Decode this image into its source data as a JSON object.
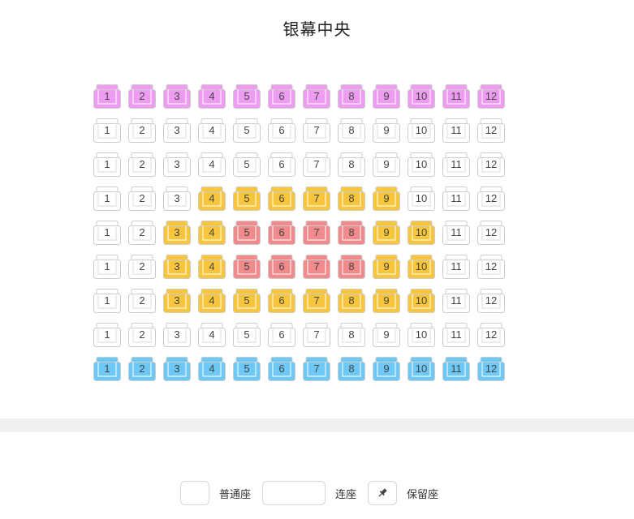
{
  "screen": {
    "title": "银幕中央"
  },
  "colors": {
    "normal": {
      "fill": "#ffffff",
      "stroke": "#cccccc"
    },
    "pink": {
      "fill": "#ee9cf2",
      "stroke": "#cccccc"
    },
    "yellow": {
      "fill": "#f8c63d",
      "stroke": "#cccccc"
    },
    "red": {
      "fill": "#f08a8c",
      "stroke": "#cccccc"
    },
    "blue": {
      "fill": "#6ec8f5",
      "stroke": "#cccccc"
    }
  },
  "seat_rows": [
    {
      "seats": [
        [
          "1",
          "pink"
        ],
        [
          "2",
          "pink"
        ],
        [
          "3",
          "pink"
        ],
        [
          "4",
          "pink"
        ],
        [
          "5",
          "pink"
        ],
        [
          "6",
          "pink"
        ],
        [
          "7",
          "pink"
        ],
        [
          "8",
          "pink"
        ],
        [
          "9",
          "pink"
        ],
        [
          "10",
          "pink"
        ],
        [
          "11",
          "pink"
        ],
        [
          "12",
          "pink"
        ]
      ]
    },
    {
      "seats": [
        [
          "1",
          "normal"
        ],
        [
          "2",
          "normal"
        ],
        [
          "3",
          "normal"
        ],
        [
          "4",
          "normal"
        ],
        [
          "5",
          "normal"
        ],
        [
          "6",
          "normal"
        ],
        [
          "7",
          "normal"
        ],
        [
          "8",
          "normal"
        ],
        [
          "9",
          "normal"
        ],
        [
          "10",
          "normal"
        ],
        [
          "11",
          "normal"
        ],
        [
          "12",
          "normal"
        ]
      ]
    },
    {
      "seats": [
        [
          "1",
          "normal"
        ],
        [
          "2",
          "normal"
        ],
        [
          "3",
          "normal"
        ],
        [
          "4",
          "normal"
        ],
        [
          "5",
          "normal"
        ],
        [
          "6",
          "normal"
        ],
        [
          "7",
          "normal"
        ],
        [
          "8",
          "normal"
        ],
        [
          "9",
          "normal"
        ],
        [
          "10",
          "normal"
        ],
        [
          "11",
          "normal"
        ],
        [
          "12",
          "normal"
        ]
      ]
    },
    {
      "seats": [
        [
          "1",
          "normal"
        ],
        [
          "2",
          "normal"
        ],
        [
          "3",
          "normal"
        ],
        [
          "4",
          "yellow"
        ],
        [
          "5",
          "yellow"
        ],
        [
          "6",
          "yellow"
        ],
        [
          "7",
          "yellow"
        ],
        [
          "8",
          "yellow"
        ],
        [
          "9",
          "yellow"
        ],
        [
          "10",
          "normal"
        ],
        [
          "11",
          "normal"
        ],
        [
          "12",
          "normal"
        ]
      ]
    },
    {
      "seats": [
        [
          "1",
          "normal"
        ],
        [
          "2",
          "normal"
        ],
        [
          "3",
          "yellow"
        ],
        [
          "4",
          "yellow"
        ],
        [
          "5",
          "red"
        ],
        [
          "6",
          "red"
        ],
        [
          "7",
          "red"
        ],
        [
          "8",
          "red"
        ],
        [
          "9",
          "yellow"
        ],
        [
          "10",
          "yellow"
        ],
        [
          "11",
          "normal"
        ],
        [
          "12",
          "normal"
        ]
      ]
    },
    {
      "seats": [
        [
          "1",
          "normal"
        ],
        [
          "2",
          "normal"
        ],
        [
          "3",
          "yellow"
        ],
        [
          "4",
          "yellow"
        ],
        [
          "5",
          "red"
        ],
        [
          "6",
          "red"
        ],
        [
          "7",
          "red"
        ],
        [
          "8",
          "red"
        ],
        [
          "9",
          "yellow"
        ],
        [
          "10",
          "yellow"
        ],
        [
          "11",
          "normal"
        ],
        [
          "12",
          "normal"
        ]
      ]
    },
    {
      "seats": [
        [
          "1",
          "normal"
        ],
        [
          "2",
          "normal"
        ],
        [
          "3",
          "yellow"
        ],
        [
          "4",
          "yellow"
        ],
        [
          "5",
          "yellow"
        ],
        [
          "6",
          "yellow"
        ],
        [
          "7",
          "yellow"
        ],
        [
          "8",
          "yellow"
        ],
        [
          "9",
          "yellow"
        ],
        [
          "10",
          "yellow"
        ],
        [
          "11",
          "normal"
        ],
        [
          "12",
          "normal"
        ]
      ]
    },
    {
      "seats": [
        [
          "1",
          "normal"
        ],
        [
          "2",
          "normal"
        ],
        [
          "3",
          "normal"
        ],
        [
          "4",
          "normal"
        ],
        [
          "5",
          "normal"
        ],
        [
          "6",
          "normal"
        ],
        [
          "7",
          "normal"
        ],
        [
          "8",
          "normal"
        ],
        [
          "9",
          "normal"
        ],
        [
          "10",
          "normal"
        ],
        [
          "11",
          "normal"
        ],
        [
          "12",
          "normal"
        ]
      ]
    },
    {
      "seats": [
        [
          "1",
          "blue"
        ],
        [
          "2",
          "blue"
        ],
        [
          "3",
          "blue"
        ],
        [
          "4",
          "blue"
        ],
        [
          "5",
          "blue"
        ],
        [
          "6",
          "blue"
        ],
        [
          "7",
          "blue"
        ],
        [
          "8",
          "blue"
        ],
        [
          "9",
          "blue"
        ],
        [
          "10",
          "blue"
        ],
        [
          "11",
          "blue"
        ],
        [
          "12",
          "blue"
        ]
      ]
    }
  ],
  "legend": {
    "normal_label": "普通座",
    "couple_label": "连座",
    "reserved_label": "保留座",
    "reserved_icon": "pin-icon"
  }
}
